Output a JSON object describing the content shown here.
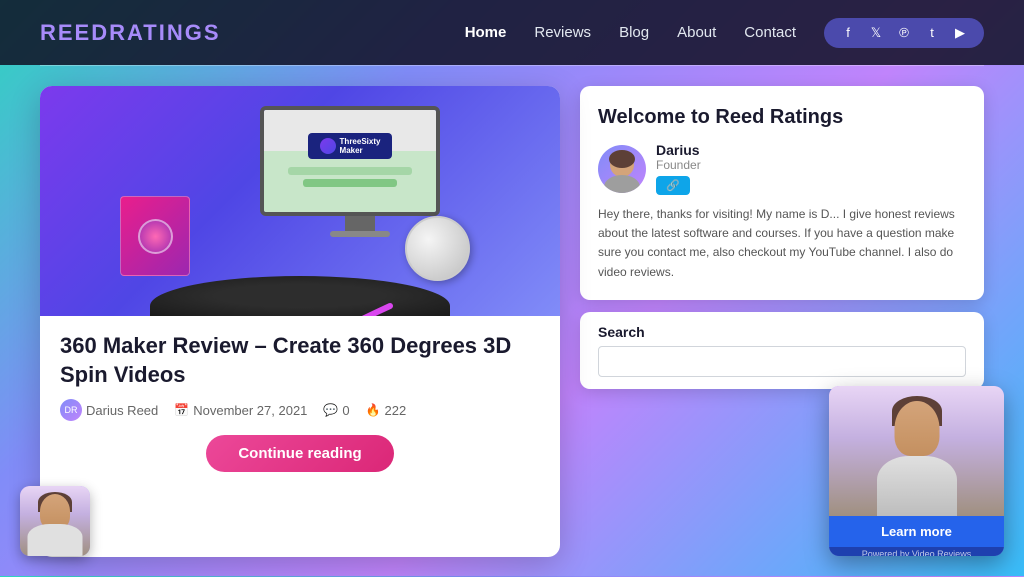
{
  "header": {
    "logo_text": "ReedRatings",
    "logo_prefix": "Reed",
    "logo_suffix": "Ratings",
    "nav": {
      "items": [
        {
          "label": "Home",
          "active": true
        },
        {
          "label": "Reviews",
          "active": false
        },
        {
          "label": "Blog",
          "active": false
        },
        {
          "label": "About",
          "active": false
        },
        {
          "label": "Contact",
          "active": false
        }
      ]
    },
    "social": [
      "f",
      "t",
      "p",
      "t",
      "▶"
    ]
  },
  "main_article": {
    "title": "360 Maker Review – Create 360 Degrees 3D Spin Videos",
    "author": "Darius Reed",
    "date": "November 27, 2021",
    "comments": "0",
    "views": "222",
    "continue_btn": "Continue reading"
  },
  "sidebar": {
    "welcome": {
      "title": "Welcome to Reed Ratings",
      "author_name": "Darius",
      "author_role": "Founder",
      "author_link_label": "●",
      "description": "Hey there, thanks for visiting! My name is D... I give honest reviews about the latest software and courses. If you have a question make sure you contact me, also checkout my YouTube channel. I also do video reviews.",
      "search_label": "Search",
      "search_placeholder": ""
    }
  },
  "video_popup": {
    "learn_more_label": "Learn more",
    "powered_label": "Powered by Video Reviews"
  },
  "colors": {
    "primary": "#c084fc",
    "secondary": "#818cf8",
    "accent_pink": "#ec4899",
    "blue": "#2563eb",
    "dark": "#1a1a2e"
  }
}
